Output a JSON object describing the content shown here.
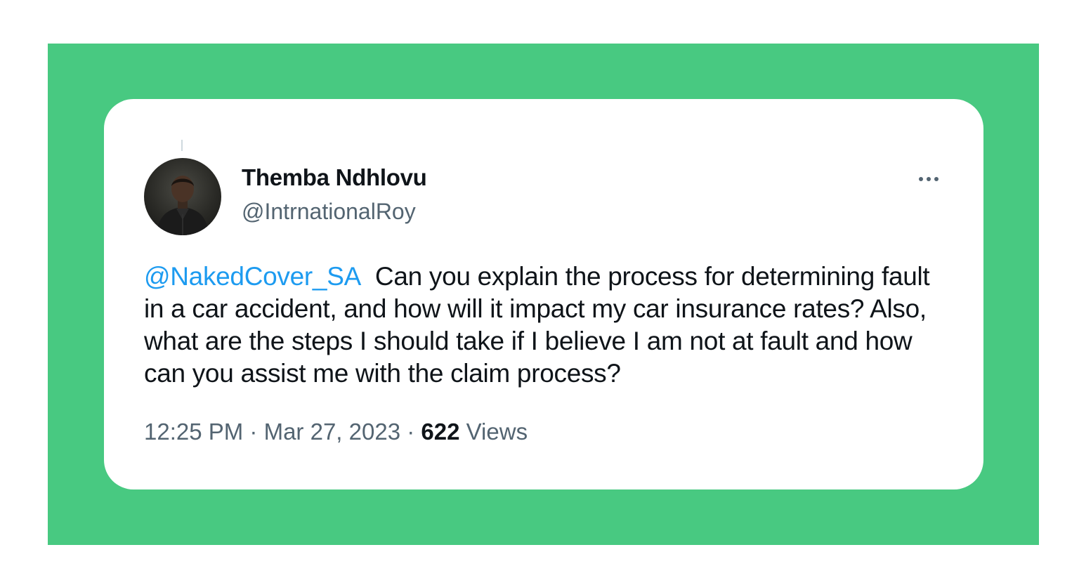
{
  "colors": {
    "frame_background": "#48c981",
    "card_background": "#ffffff",
    "mention_blue": "#1d9bf0",
    "text_primary": "#0f1419",
    "text_secondary": "#536471"
  },
  "tweet": {
    "author": {
      "display_name": "Themba Ndhlovu",
      "handle": "@IntrnationalRoy",
      "avatar_icon": "profile-photo"
    },
    "more_icon": "more-horizontal-icon",
    "mention": "@NakedCover_SA",
    "body": "Can you explain the process for determining fault in a car accident, and how will it impact my car insurance rates? Also, what are the steps I should take if I believe I am not at fault and how can you assist me with the claim process?",
    "time": "12:25 PM",
    "separator": "·",
    "date": "Mar 27, 2023",
    "views_count": "622",
    "views_label": "Views"
  }
}
